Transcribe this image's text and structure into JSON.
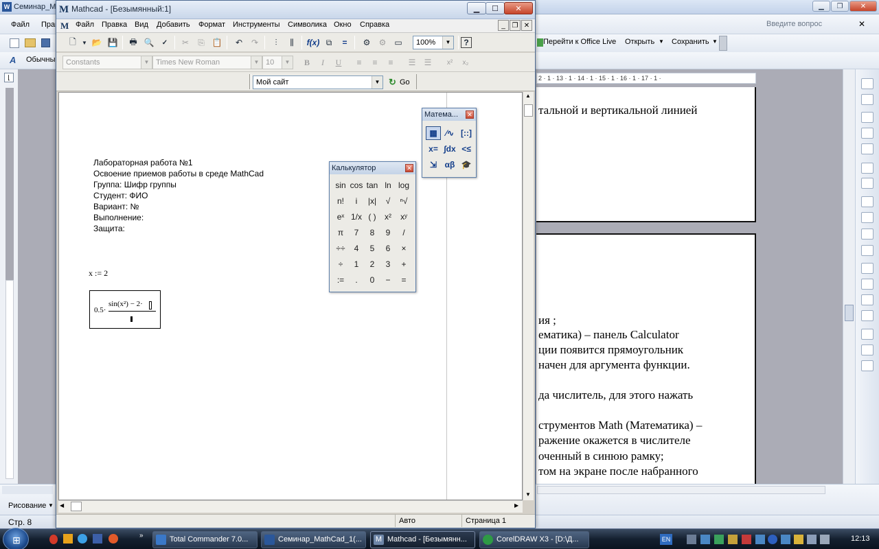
{
  "word": {
    "title": "Семинар_Ма",
    "menus": [
      "Файл",
      "Прав"
    ],
    "question_placeholder": "Введите вопрос",
    "office_live_label": "Перейти к Office Live",
    "open_label": "Открыть",
    "save_label": "Сохранить",
    "style_label": "Обычны",
    "ruler": "2 · 1 · 13 · 1 · 14 · 1 · 15 · 1 · 16 · 1 · 17 · 1 ·",
    "doc_lines_top": [
      "тальной и вертикальной линией"
    ],
    "doc_lines": [
      "ия ;",
      "ематика) – панель Calculator",
      "ции появится прямоугольник",
      "начен для аргумента функции.",
      "да числитель, для этого нажать",
      "струментов Math (Математика) –",
      "ражение окажется в числителе",
      "оченный в синюю рамку;",
      "том на экране после набранного"
    ],
    "draw_label": "Рисование",
    "status_page": "Стр. 8"
  },
  "mathcad": {
    "title": "Mathcad - [Безымянный:1]",
    "menu": [
      "Файл",
      "Правка",
      "Вид",
      "Добавить",
      "Формат",
      "Инструменты",
      "Символика",
      "Окно",
      "Справка"
    ],
    "zoom": "100%",
    "style": "Constants",
    "font": "Times New Roman",
    "size": "10",
    "site": "Мой сайт",
    "go_label": "Go",
    "text_block": [
      "Лабораторная работа №1",
      "Освоение приемов работы в среде MathCad",
      "Группа: Шифр группы",
      "Студент: ФИО",
      "Вариант: №",
      "Выполнение:",
      "Защита:"
    ],
    "assign": "x := 2",
    "expr": {
      "coef": "0.5·",
      "num": "sin(x²) − 2·",
      "den": ""
    },
    "status_mode": "Авто",
    "status_page": "Страница 1"
  },
  "calculator": {
    "title": "Калькулятор",
    "rows": [
      [
        "sin",
        "cos",
        "tan",
        "ln",
        "log"
      ],
      [
        "n!",
        "i",
        "|x|",
        "√",
        "ⁿ√"
      ],
      [
        "eˣ",
        "1/x",
        "( )",
        "x²",
        "xʸ"
      ],
      [
        "π",
        "7",
        "8",
        "9",
        "/"
      ],
      [
        "÷÷",
        "4",
        "5",
        "6",
        "×"
      ],
      [
        "÷",
        "1",
        "2",
        "3",
        "+"
      ],
      [
        ":=",
        ".",
        "0",
        "−",
        "="
      ]
    ]
  },
  "math_palette": {
    "title": "Матема...",
    "buttons": [
      [
        "▦",
        "⁄∿",
        "[::]"
      ],
      [
        "x=",
        "∫dx",
        "<≤"
      ],
      [
        "⇲",
        "αβ",
        "🎓"
      ]
    ]
  },
  "taskbar": {
    "tasks": [
      "Total Commander 7.0...",
      "Семинар_MathCad_1(...",
      "Mathcad - [Безымянн...",
      "CorelDRAW X3 - [D:\\Д..."
    ],
    "lang": "EN",
    "time": "12:13"
  }
}
